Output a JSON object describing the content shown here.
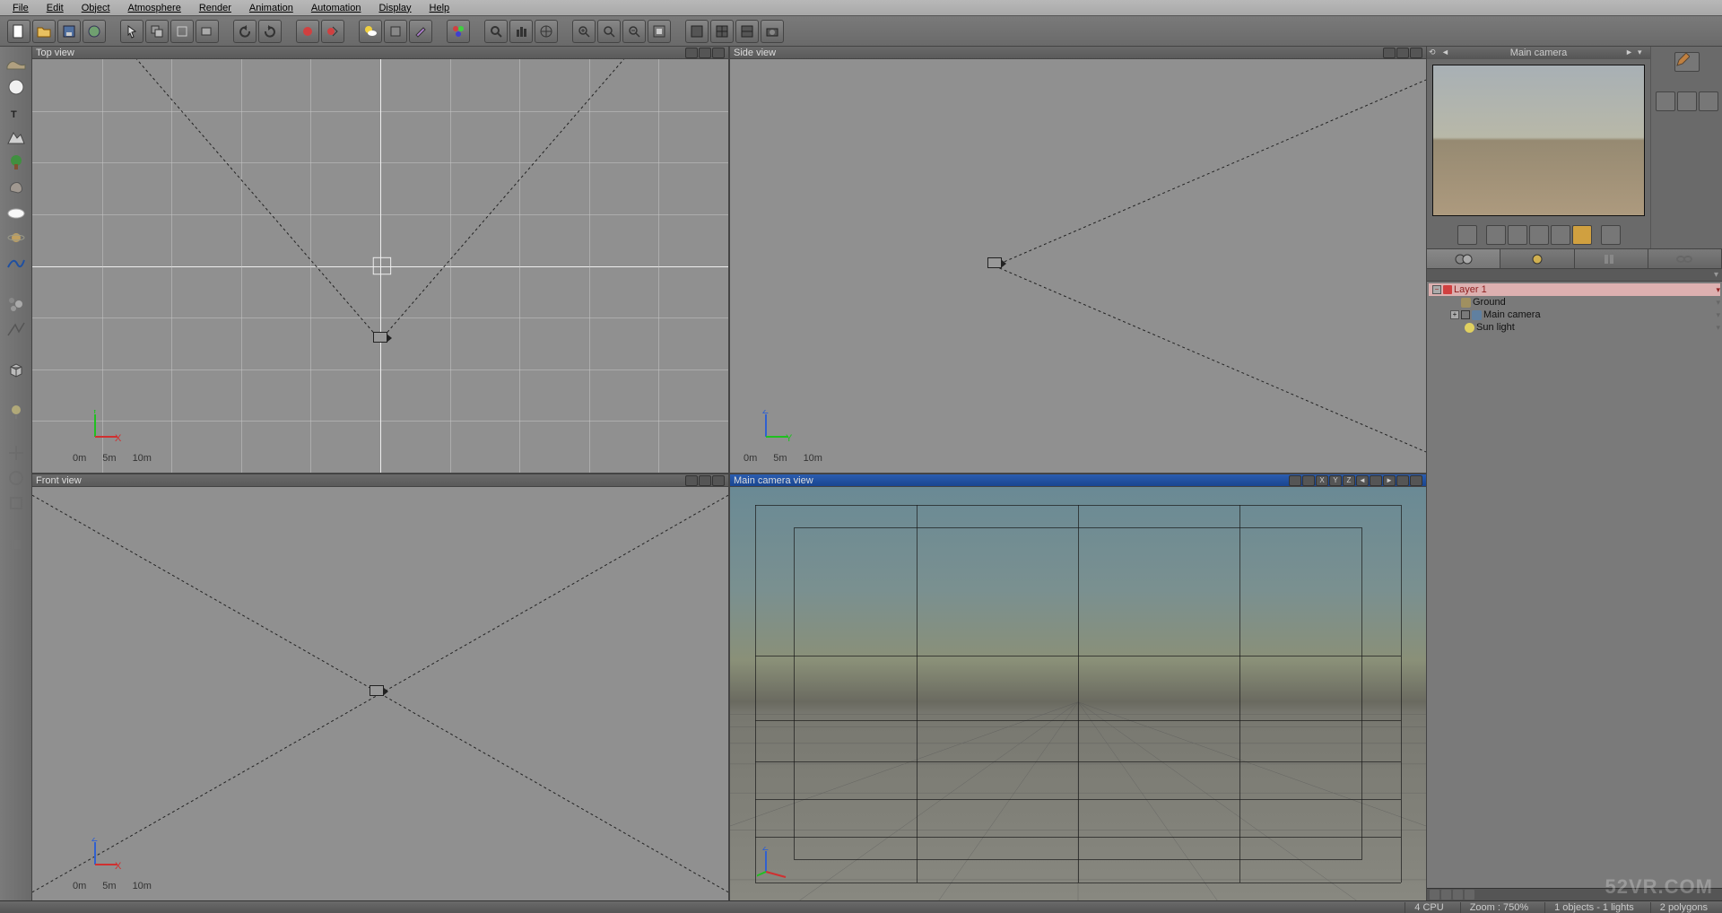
{
  "menu": [
    "File",
    "Edit",
    "Object",
    "Atmosphere",
    "Render",
    "Animation",
    "Automation",
    "Display",
    "Help"
  ],
  "viewports": {
    "top": {
      "title": "Top view",
      "scale": [
        "0m",
        "5m",
        "10m"
      ],
      "axis": {
        "up": "Y",
        "right": "X",
        "upColor": "#20c020",
        "rightColor": "#d03030"
      }
    },
    "side": {
      "title": "Side view",
      "scale": [
        "0m",
        "5m",
        "10m"
      ],
      "axis": {
        "up": "Z",
        "right": "Y",
        "upColor": "#3060d0",
        "rightColor": "#20c020"
      }
    },
    "front": {
      "title": "Front view",
      "scale": [
        "0m",
        "5m",
        "10m"
      ],
      "axis": {
        "up": "Z",
        "right": "X",
        "upColor": "#3060d0",
        "rightColor": "#d03030"
      }
    },
    "camera": {
      "title": "Main camera view",
      "axis": {
        "up": "Z",
        "rightColor": "#d03030",
        "upColor": "#3060d0"
      }
    }
  },
  "preview": {
    "title": "Main camera"
  },
  "scene_tree": {
    "layer": "Layer 1",
    "items": [
      {
        "label": "Ground",
        "indent": 1,
        "expand": "-"
      },
      {
        "label": "Main camera",
        "indent": 1,
        "expand": "+",
        "box": true
      },
      {
        "label": "Sun light",
        "indent": 2,
        "expand": ""
      }
    ]
  },
  "statusbar": {
    "cpu": "4 CPU",
    "zoom": "Zoom : 750%",
    "objects": "1 objects - 1 lights",
    "polys": "2 polygons"
  },
  "watermark": "52VR.COM"
}
